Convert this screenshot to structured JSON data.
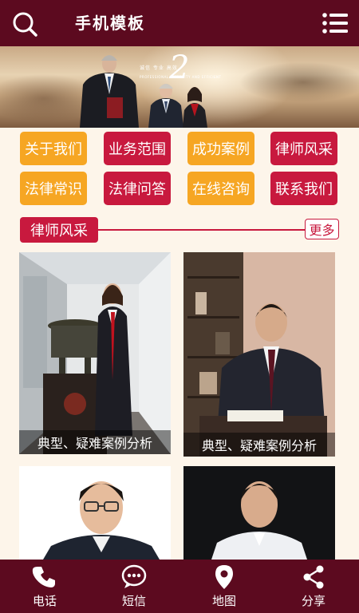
{
  "header": {
    "title": "手机模板",
    "search_icon": "search-icon",
    "menu_icon": "menu-icon"
  },
  "banner": {
    "slogan": "诚信  专业  高效",
    "number": "2",
    "subtitle": "PROFESSIONAL INTEGRITY AND EFFICIENT"
  },
  "nav": [
    {
      "label": "关于我们",
      "color": "#f6a623"
    },
    {
      "label": "业务范围",
      "color": "#c8193e"
    },
    {
      "label": "成功案例",
      "color": "#f6a623"
    },
    {
      "label": "律师风采",
      "color": "#c8193e"
    },
    {
      "label": "法律常识",
      "color": "#f6a623"
    },
    {
      "label": "法律问答",
      "color": "#c8193e"
    },
    {
      "label": "在线咨询",
      "color": "#f6a623"
    },
    {
      "label": "联系我们",
      "color": "#c8193e"
    }
  ],
  "section": {
    "title": "律师风采",
    "more": "更多"
  },
  "cards": [
    {
      "caption": "典型、疑难案例分析"
    },
    {
      "caption": "典型、疑难案例分析"
    },
    {
      "caption": ""
    },
    {
      "caption": ""
    }
  ],
  "footer": [
    {
      "label": "电话",
      "icon": "phone-icon"
    },
    {
      "label": "短信",
      "icon": "message-icon"
    },
    {
      "label": "地图",
      "icon": "map-pin-icon"
    },
    {
      "label": "分享",
      "icon": "share-icon"
    }
  ],
  "colors": {
    "header": "#5c0a1f",
    "accent_red": "#c8193e",
    "accent_yellow": "#f6a623",
    "background": "#fdf5ea"
  }
}
